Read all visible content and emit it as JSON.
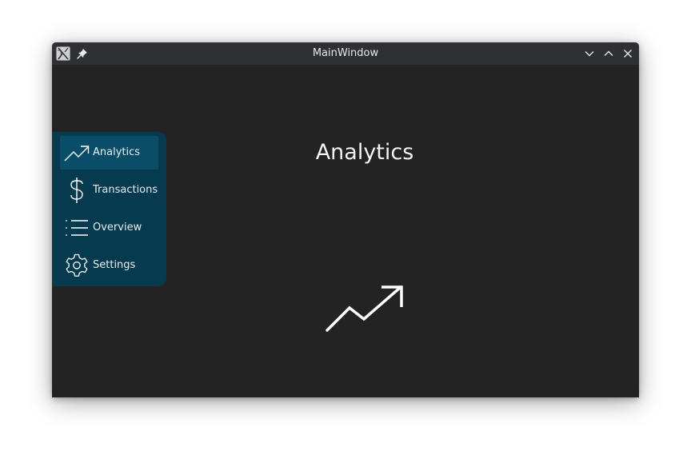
{
  "window": {
    "title": "MainWindow"
  },
  "titlebar": {
    "buttons": [
      "minimize-icon",
      "maximize-icon",
      "close-icon"
    ]
  },
  "sidebar": {
    "items": [
      {
        "label": "Analytics",
        "icon": "trending-up-icon",
        "active": true
      },
      {
        "label": "Transactions",
        "icon": "dollar-icon",
        "active": false
      },
      {
        "label": "Overview",
        "icon": "list-icon",
        "active": false
      },
      {
        "label": "Settings",
        "icon": "gear-icon",
        "active": false
      }
    ]
  },
  "main": {
    "title": "Analytics",
    "icon": "trending-up-icon"
  },
  "colors": {
    "sidebar_bg": "#063a4f",
    "active_item_bg": "#0a4d68",
    "content_bg": "#232323",
    "titlebar_bg": "#2e3034"
  }
}
